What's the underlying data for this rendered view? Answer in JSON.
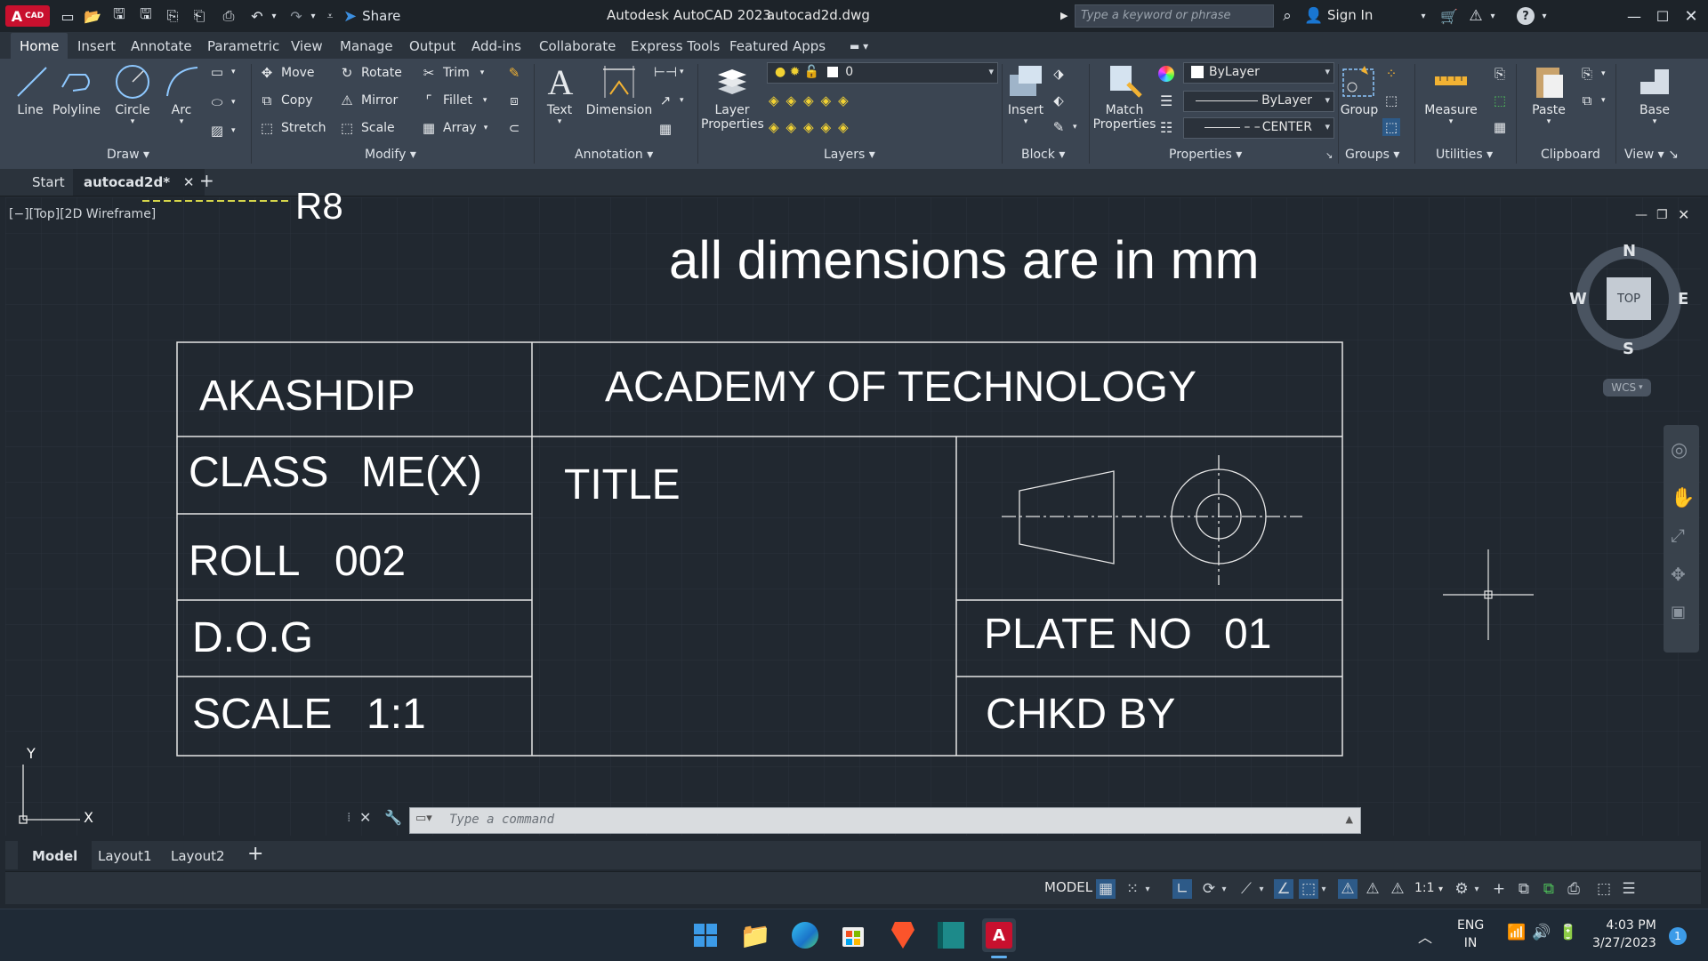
{
  "app": {
    "window_title": "Autodesk AutoCAD 2023",
    "file_name": "autocad2d.dwg",
    "share_label": "Share",
    "search_placeholder": "Type a keyword or phrase",
    "sign_in_label": "Sign In",
    "logo_text": "CAD",
    "logo_letter": "A"
  },
  "ribbon_tabs": [
    "Home",
    "Insert",
    "Annotate",
    "Parametric",
    "View",
    "Manage",
    "Output",
    "Add-ins",
    "Collaborate",
    "Express Tools",
    "Featured Apps"
  ],
  "active_tab": "Home",
  "ribbon": {
    "draw": {
      "title": "Draw",
      "line": "Line",
      "polyline": "Polyline",
      "circle": "Circle",
      "arc": "Arc"
    },
    "modify": {
      "title": "Modify",
      "move": "Move",
      "rotate": "Rotate",
      "trim": "Trim",
      "copy": "Copy",
      "mirror": "Mirror",
      "fillet": "Fillet",
      "stretch": "Stretch",
      "scale": "Scale",
      "array": "Array"
    },
    "annotation": {
      "title": "Annotation",
      "text": "Text",
      "dimension": "Dimension"
    },
    "layers": {
      "title": "Layers",
      "layer_properties_1": "Layer",
      "layer_properties_2": "Properties",
      "current_layer": "0"
    },
    "block": {
      "title": "Block",
      "insert": "Insert"
    },
    "properties": {
      "title": "Properties",
      "match_1": "Match",
      "match_2": "Properties",
      "color": "ByLayer",
      "lineweight": "ByLayer",
      "linetype": "CENTER",
      "linetype_prefix": "– –"
    },
    "groups": {
      "title": "Groups",
      "group": "Group"
    },
    "utilities": {
      "title": "Utilities",
      "measure": "Measure"
    },
    "clipboard": {
      "title": "Clipboard",
      "paste": "Paste"
    },
    "view": {
      "title": "View",
      "base": "Base"
    }
  },
  "file_tabs": {
    "start": "Start",
    "current": "autocad2d*"
  },
  "viewport": {
    "controls": "[−][Top][2D Wireframe]",
    "viewcube": {
      "n": "N",
      "s": "S",
      "e": "E",
      "w": "W",
      "top": "TOP",
      "wcs": "WCS"
    },
    "ucs_x": "X",
    "ucs_y": "Y"
  },
  "drawing": {
    "partial_text": "R8",
    "note": "all dimensions are in mm",
    "name": "AKASHDIP",
    "institute": "ACADEMY OF TECHNOLOGY",
    "class_label": "CLASS",
    "class_value": "ME(X)",
    "title_label": "TITLE",
    "roll_label": "ROLL",
    "roll_value": "002",
    "dog_label": "D.O.G",
    "scale_label": "SCALE",
    "scale_value": "1:1",
    "plate_label": "PLATE NO",
    "plate_value": "01",
    "checked_label": "CHKD BY"
  },
  "command_line": {
    "placeholder": "Type a command"
  },
  "layout_tabs": [
    "Model",
    "Layout1",
    "Layout2"
  ],
  "status": {
    "model": "MODEL",
    "scale": "1:1"
  },
  "taskbar": {
    "lang_1": "ENG",
    "lang_2": "IN",
    "time": "4:03 PM",
    "date": "3/27/2023",
    "notifications": "1"
  },
  "colors": {
    "accent_blue": "#3c8fe0",
    "autocad_red": "#c8102e",
    "canvas": "#212830"
  }
}
